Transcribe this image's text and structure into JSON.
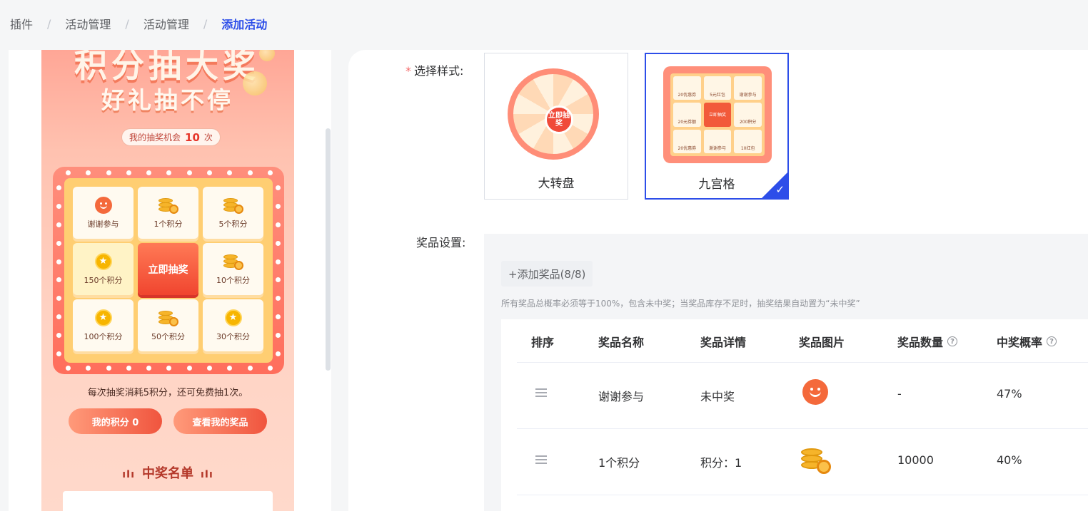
{
  "breadcrumb": {
    "items": [
      "插件",
      "活动管理",
      "活动管理"
    ],
    "current": "添加活动",
    "separator": "/"
  },
  "preview": {
    "title": "积分抽大奖",
    "subtitle": "好礼抽不停",
    "chance_label": "我的抽奖机会",
    "chance_count": "10",
    "chance_unit": "次",
    "grid": [
      {
        "label": "谢谢参与",
        "icon": "smile-icon"
      },
      {
        "label": "1个积分",
        "icon": "coins-icon"
      },
      {
        "label": "5个积分",
        "icon": "coins-icon"
      },
      {
        "label": "150个积分",
        "icon": "star-coin-icon"
      },
      {
        "label": "立即抽奖",
        "icon": ""
      },
      {
        "label": "10个积分",
        "icon": "coins-icon"
      },
      {
        "label": "100个积分",
        "icon": "star-coin-icon"
      },
      {
        "label": "50个积分",
        "icon": "coins-icon"
      },
      {
        "label": "30个积分",
        "icon": "star-coin-icon"
      }
    ],
    "consume_note": "每次抽奖消耗5积分，还可免费抽1次。",
    "my_points_button": "我的积分 0",
    "my_prizes_button": "查看我的奖品",
    "winners_title": "中奖名单"
  },
  "form": {
    "style_label": "选择样式:",
    "styles": [
      {
        "name": "大转盘",
        "selected": false
      },
      {
        "name": "九宫格",
        "selected": true
      }
    ],
    "wheel_center_text": "立即抽奖",
    "nine_grid_thumb": [
      "20优惠券",
      "5元红包",
      "谢谢参与",
      "20元券额",
      "立即抽奖",
      "200积分",
      "20优惠券",
      "谢谢参与",
      "10红包"
    ],
    "prize_label": "奖品设置:",
    "add_prize_button": "+添加奖品(8/8)",
    "hint": "所有奖品总概率必须等于100%，包含未中奖；当奖品库存不足时，抽奖结果自动置为“未中奖”",
    "table": {
      "headers": [
        "排序",
        "奖品名称",
        "奖品详情",
        "奖品图片",
        "奖品数量",
        "中奖概率"
      ],
      "rows": [
        {
          "name": "谢谢参与",
          "detail": "未中奖",
          "image": "smile-icon",
          "quantity": "-",
          "probability": "47%"
        },
        {
          "name": "1个积分",
          "detail": "积分：1",
          "image": "coins-icon",
          "quantity": "10000",
          "probability": "40%"
        }
      ]
    }
  },
  "colors": {
    "accent": "#2d4ee9",
    "required": "#f56c6c",
    "prize_orange": "#f4693b",
    "coin_gold": "#f6b42a"
  }
}
